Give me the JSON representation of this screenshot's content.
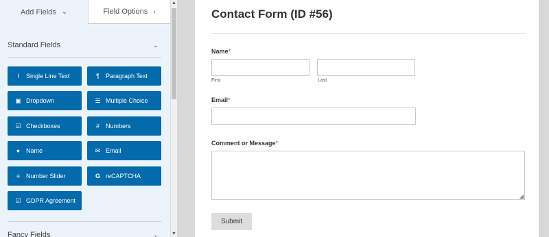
{
  "tabs": {
    "add_fields": "Add Fields",
    "field_options": "Field Options"
  },
  "sections": {
    "standard": "Standard Fields",
    "fancy": "Fancy Fields"
  },
  "standard_fields": [
    {
      "label": "Single Line Text",
      "icon": "text-cursor-icon",
      "glyph": "Ⅰ"
    },
    {
      "label": "Paragraph Text",
      "icon": "paragraph-icon",
      "glyph": "¶"
    },
    {
      "label": "Dropdown",
      "icon": "dropdown-icon",
      "glyph": "▣"
    },
    {
      "label": "Multiple Choice",
      "icon": "list-icon",
      "glyph": "☰"
    },
    {
      "label": "Checkboxes",
      "icon": "checkbox-icon",
      "glyph": "☑"
    },
    {
      "label": "Numbers",
      "icon": "hash-icon",
      "glyph": "#"
    },
    {
      "label": "Name",
      "icon": "user-icon",
      "glyph": "●"
    },
    {
      "label": "Email",
      "icon": "envelope-icon",
      "glyph": "✉"
    },
    {
      "label": "Number Slider",
      "icon": "sliders-icon",
      "glyph": "≡"
    },
    {
      "label": "reCAPTCHA",
      "icon": "google-icon",
      "glyph": "G"
    },
    {
      "label": "GDPR Agreement",
      "icon": "checkbox-icon",
      "glyph": "☑"
    }
  ],
  "form": {
    "title": "Contact Form (ID #56)",
    "name_label": "Name",
    "first_sublabel": "First",
    "last_sublabel": "Last",
    "email_label": "Email",
    "message_label": "Comment or Message",
    "required_mark": "*",
    "submit_label": "Submit"
  },
  "colors": {
    "field_button": "#036aab",
    "panel_bg": "#ebf3fb",
    "required": "#d63638"
  }
}
